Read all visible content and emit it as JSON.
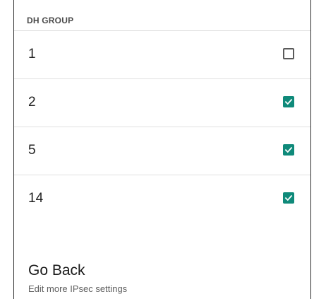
{
  "section": {
    "title": "DH GROUP"
  },
  "dh_groups": [
    {
      "label": "1",
      "checked": false
    },
    {
      "label": "2",
      "checked": true
    },
    {
      "label": "5",
      "checked": true
    },
    {
      "label": "14",
      "checked": true
    }
  ],
  "go_back": {
    "title": "Go Back",
    "subtitle": "Edit more IPsec settings"
  },
  "colors": {
    "checkbox_on": "#0f8a7a",
    "checkbox_off_border": "#5a5a5a"
  }
}
